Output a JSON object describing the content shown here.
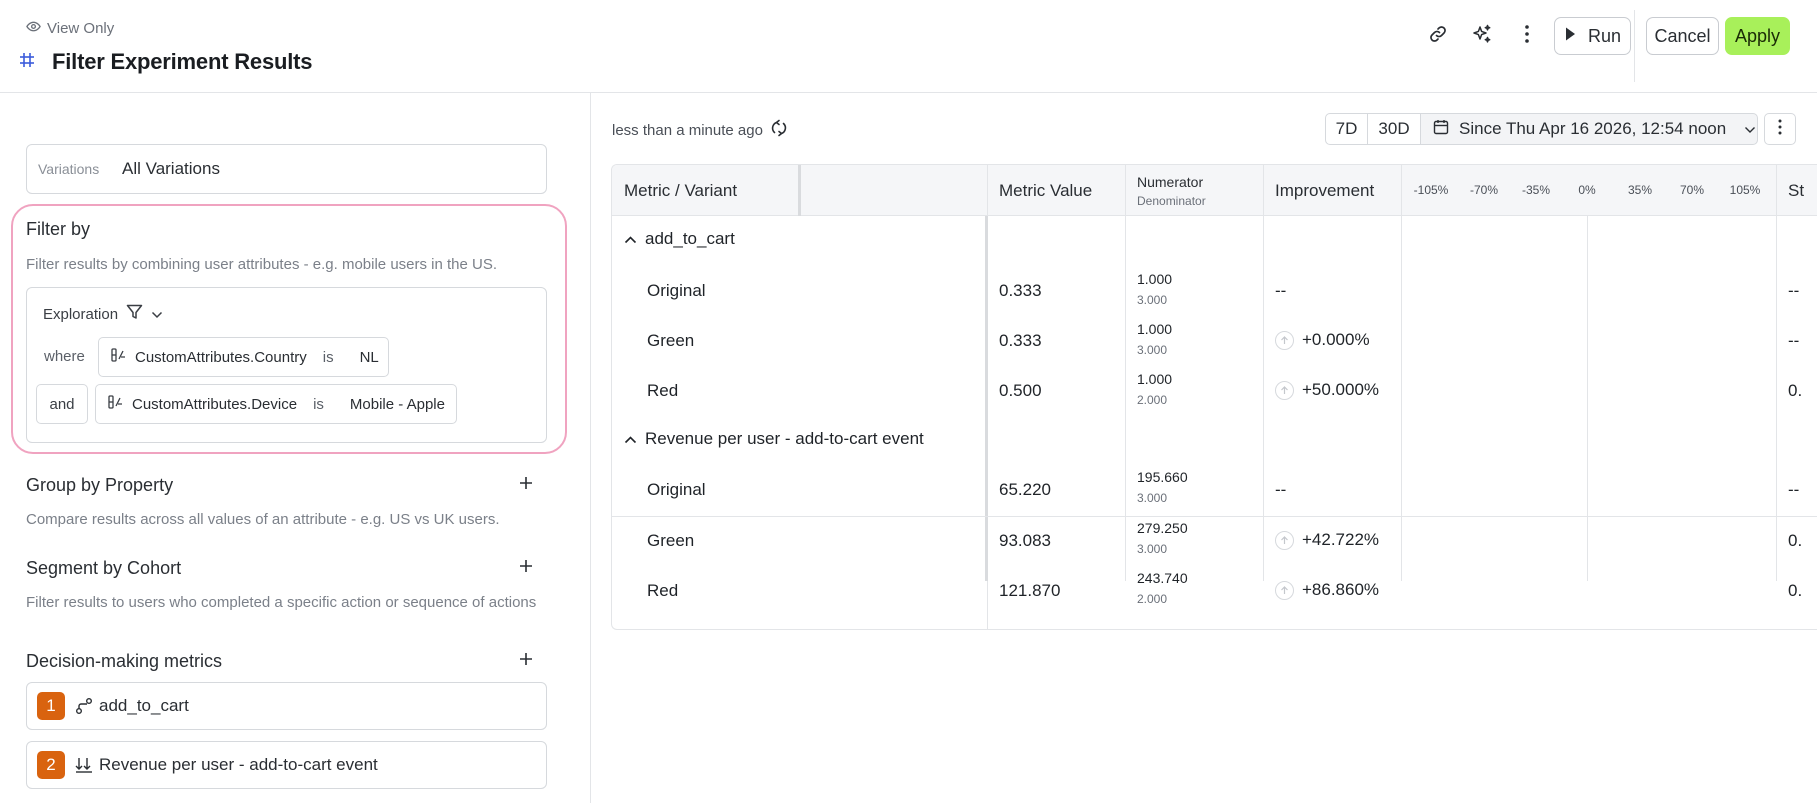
{
  "header": {
    "view_mode": "View Only",
    "title": "Filter Experiment Results",
    "run_label": "Run",
    "cancel_label": "Cancel",
    "apply_label": "Apply"
  },
  "variations": {
    "label": "Variations",
    "value": "All Variations"
  },
  "filter": {
    "title": "Filter by",
    "description": "Filter results by combining user attributes - e.g. mobile users in the US.",
    "mode_label": "Exploration",
    "where_label": "where",
    "and_label": "and",
    "conditions": [
      {
        "attribute": "CustomAttributes.Country",
        "operator": "is",
        "value": "NL"
      },
      {
        "attribute": "CustomAttributes.Device",
        "operator": "is",
        "value": "Mobile - Apple"
      }
    ]
  },
  "group_by": {
    "title": "Group by Property",
    "description": "Compare results across all values of an attribute - e.g. US vs UK users."
  },
  "segment": {
    "title": "Segment by Cohort",
    "description": "Filter results to users who completed a specific action or sequence of actions"
  },
  "metrics": {
    "title": "Decision-making metrics",
    "items": [
      {
        "number": "1",
        "label": "add_to_cart"
      },
      {
        "number": "2",
        "label": "Revenue per user - add-to-cart event"
      }
    ]
  },
  "results": {
    "last_refreshed": "less than a minute ago",
    "ranges": [
      "7D",
      "30D"
    ],
    "date_range": "Since Thu Apr 16 2026, 12:54 noon",
    "columns": {
      "metric_variant": "Metric / Variant",
      "metric_value": "Metric Value",
      "numerator": "Numerator",
      "denominator": "Denominator",
      "improvement": "Improvement",
      "ticks": [
        "-105%",
        "-70%",
        "-35%",
        "0%",
        "35%",
        "70%",
        "105%"
      ],
      "next_col_partial": "St"
    },
    "groups": [
      {
        "name": "add_to_cart",
        "rows": [
          {
            "variant": "Original",
            "value": "0.333",
            "numerator": "1.000",
            "denominator": "3.000",
            "improvement": "--",
            "extra": "--"
          },
          {
            "variant": "Green",
            "value": "0.333",
            "numerator": "1.000",
            "denominator": "3.000",
            "improvement": "+0.000%",
            "extra": "--"
          },
          {
            "variant": "Red",
            "value": "0.500",
            "numerator": "1.000",
            "denominator": "2.000",
            "improvement": "+50.000%",
            "extra": "0."
          }
        ]
      },
      {
        "name": "Revenue per user - add-to-cart event",
        "rows": [
          {
            "variant": "Original",
            "value": "65.220",
            "numerator": "195.660",
            "denominator": "3.000",
            "improvement": "--",
            "extra": "--"
          },
          {
            "variant": "Green",
            "value": "93.083",
            "numerator": "279.250",
            "denominator": "3.000",
            "improvement": "+42.722%",
            "extra": "0."
          },
          {
            "variant": "Red",
            "value": "121.870",
            "numerator": "243.740",
            "denominator": "2.000",
            "improvement": "+86.860%",
            "extra": "0."
          }
        ]
      }
    ]
  },
  "colors": {
    "accent_apply": "#a8f05a",
    "highlight_border": "#f0a3c0",
    "metric_badge": "#d9630f"
  }
}
